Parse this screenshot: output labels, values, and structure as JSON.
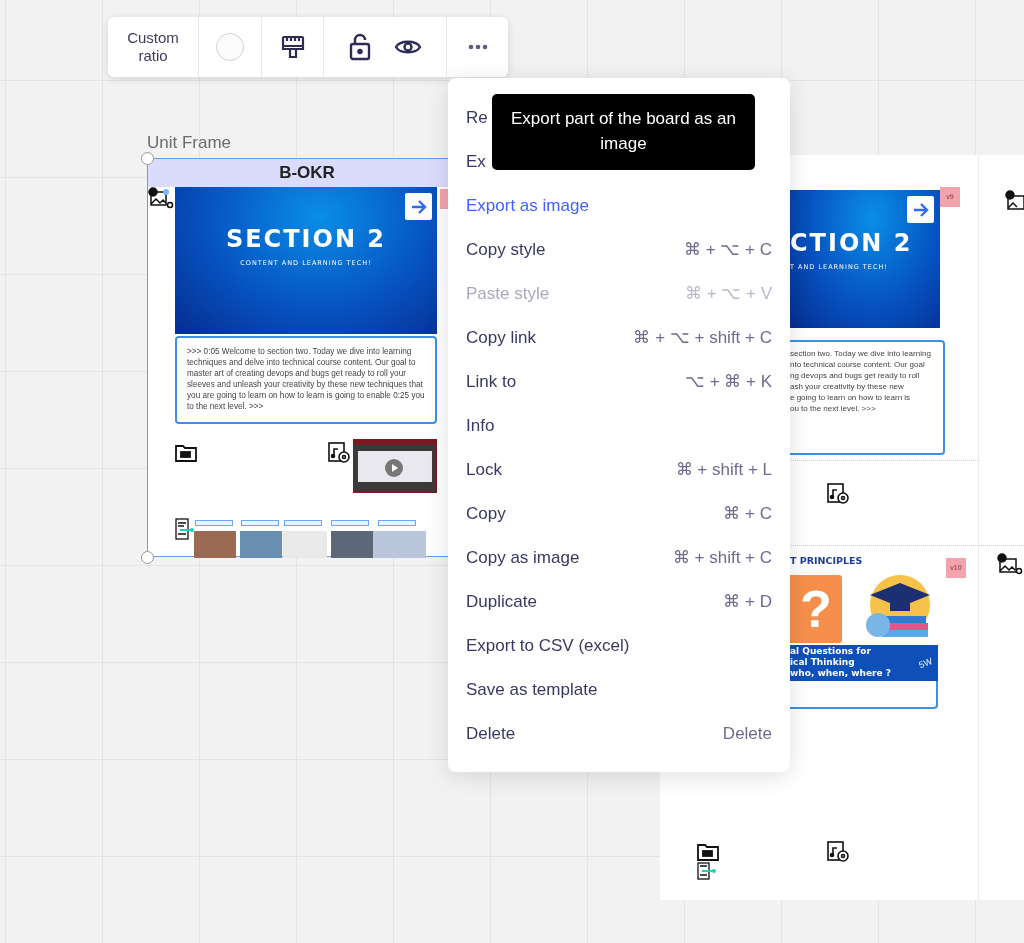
{
  "toolbar": {
    "ratio_button": "Custom ratio",
    "locked": false
  },
  "frame": {
    "label": "Unit Frame",
    "title": "B-OKR",
    "slide": {
      "title": "SECTION 2",
      "subtitle": "CONTENT AND LEARNING TECH!"
    },
    "transcript": ">>>  0:05 Welcome to section two. Today we dive into learning techniques and delve into technical course content. Our goal to master art of creating devops and bugs get ready to roll your sleeves and unleash your creativity by these new techniques that you are going to learn on how to learn is going to enable 0:25 you to the next level. >>>"
  },
  "board": {
    "slide": {
      "title": "CTION 2",
      "subtitle": "T AND LEARNING TECH!"
    },
    "sticky_1": "v9",
    "transcript_lines": [
      "section two. Today we dive into learning",
      "nto technical course content. Our goal",
      "ng devops and bugs get ready to roll",
      "ash your creativity by these new",
      "e going to learn on how to learn is",
      "ou to the next level. >>>"
    ],
    "section_title": "T PRINCIPLES",
    "sticky_2": "v10",
    "question_mark": "?",
    "banner_lines": [
      "al Questions for",
      "ical Thinking",
      "who, when, where ?"
    ],
    "banner_tag": "5W"
  },
  "menu": {
    "items": [
      {
        "label": "Re",
        "disabled": false,
        "highlighted": false
      },
      {
        "label": "Ex",
        "disabled": false,
        "highlighted": false
      },
      {
        "label": "Export as image",
        "disabled": false,
        "highlighted": true
      },
      {
        "label": "Copy style",
        "shortcut": "⌘ + ⌥ + C",
        "disabled": false,
        "highlighted": false
      },
      {
        "label": "Paste style",
        "shortcut": "⌘ + ⌥ + V",
        "disabled": true,
        "highlighted": false
      },
      {
        "label": "Copy link",
        "shortcut": "⌘ + ⌥ + shift + C",
        "disabled": false,
        "highlighted": false
      },
      {
        "label": "Link to",
        "shortcut": "⌥ + ⌘ + K",
        "disabled": false,
        "highlighted": false
      },
      {
        "label": "Info",
        "disabled": false,
        "highlighted": false
      },
      {
        "label": "Lock",
        "shortcut": "⌘ + shift + L",
        "disabled": false,
        "highlighted": false
      },
      {
        "label": "Copy",
        "shortcut": "⌘ + C",
        "disabled": false,
        "highlighted": false
      },
      {
        "label": "Copy as image",
        "shortcut": "⌘ + shift + C",
        "disabled": false,
        "highlighted": false
      },
      {
        "label": "Duplicate",
        "shortcut": "⌘ + D",
        "disabled": false,
        "highlighted": false
      },
      {
        "label": "Export to CSV (excel)",
        "disabled": false,
        "highlighted": false
      },
      {
        "label": "Save as template",
        "disabled": false,
        "highlighted": false
      },
      {
        "label": "Delete",
        "shortcut": "Delete",
        "disabled": false,
        "highlighted": false
      }
    ]
  },
  "tooltip": "Export part of the board as an image"
}
